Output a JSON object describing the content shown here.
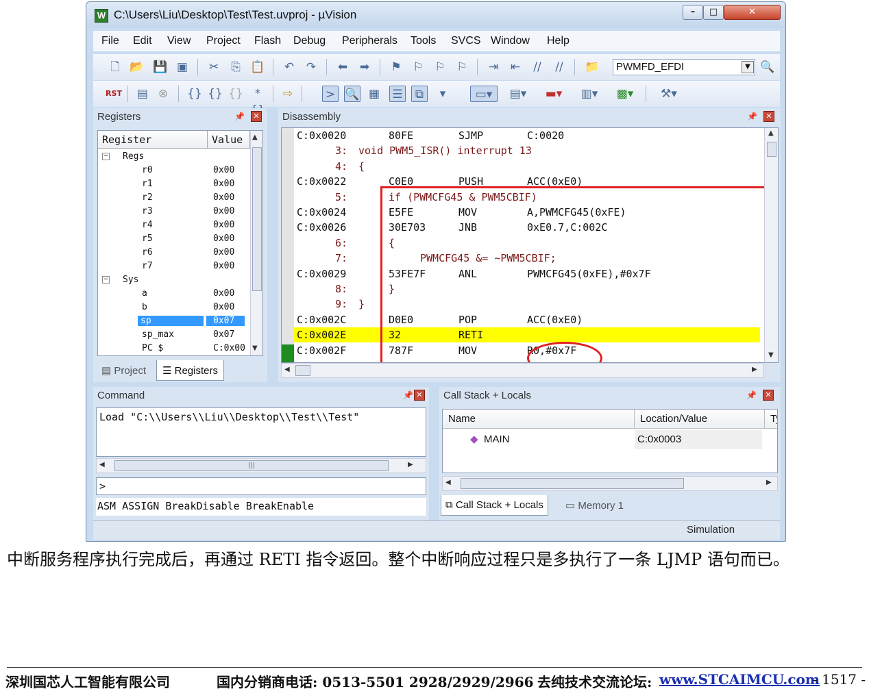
{
  "window": {
    "title": "C:\\Users\\Liu\\Desktop\\Test\\Test.uvproj - µVision"
  },
  "menu": [
    "File",
    "Edit",
    "View",
    "Project",
    "Flash",
    "Debug",
    "Peripherals",
    "Tools",
    "SVCS",
    "Window",
    "Help"
  ],
  "toolbar": {
    "target": "PWMFD_EFDI",
    "rst_label": "RST"
  },
  "registers": {
    "title": "Registers",
    "col_register": "Register",
    "col_value": "Value",
    "groups": [
      {
        "name": "Regs",
        "items": [
          {
            "name": "r0",
            "value": "0x00"
          },
          {
            "name": "r1",
            "value": "0x00"
          },
          {
            "name": "r2",
            "value": "0x00"
          },
          {
            "name": "r3",
            "value": "0x00"
          },
          {
            "name": "r4",
            "value": "0x00"
          },
          {
            "name": "r5",
            "value": "0x00"
          },
          {
            "name": "r6",
            "value": "0x00"
          },
          {
            "name": "r7",
            "value": "0x00"
          }
        ]
      },
      {
        "name": "Sys",
        "items": [
          {
            "name": "a",
            "value": "0x00"
          },
          {
            "name": "b",
            "value": "0x00"
          },
          {
            "name": "sp",
            "value": "0x07",
            "selected": true
          },
          {
            "name": "sp_max",
            "value": "0x07"
          },
          {
            "name": "PC  $",
            "value": "C:0x00"
          }
        ]
      }
    ],
    "tabs": [
      "Project",
      "Registers"
    ]
  },
  "disassembly": {
    "title": "Disassembly",
    "lines": [
      {
        "kind": "asm",
        "addr": "C:0x0020",
        "code": "80FE",
        "mnem": "SJMP",
        "ops": "C:0020"
      },
      {
        "kind": "src",
        "num": "3:",
        "text": "void PWM5_ISR() interrupt 13"
      },
      {
        "kind": "src",
        "num": "4:",
        "text": "{"
      },
      {
        "kind": "asm",
        "addr": "C:0x0022",
        "code": "C0E0",
        "mnem": "PUSH",
        "ops": "ACC(0xE0)"
      },
      {
        "kind": "src",
        "num": "5:",
        "text": "if (PWMCFG45 & PWM5CBIF)"
      },
      {
        "kind": "asm",
        "addr": "C:0x0024",
        "code": "E5FE",
        "mnem": "MOV",
        "ops": "A,PWMCFG45(0xFE)"
      },
      {
        "kind": "asm",
        "addr": "C:0x0026",
        "code": "30E703",
        "mnem": "JNB",
        "ops": "0xE0.7,C:002C"
      },
      {
        "kind": "src",
        "num": "6:",
        "text": "{"
      },
      {
        "kind": "src2",
        "num": "7:",
        "text": "PWMCFG45 &= ~PWM5CBIF;"
      },
      {
        "kind": "asm",
        "addr": "C:0x0029",
        "code": "53FE7F",
        "mnem": "ANL",
        "ops": "PWMCFG45(0xFE),#0x7F"
      },
      {
        "kind": "src",
        "num": "8:",
        "text": "}"
      },
      {
        "kind": "src",
        "num": "9:",
        "text": "}"
      },
      {
        "kind": "asm",
        "addr": "C:0x002C",
        "code": "D0E0",
        "mnem": "POP",
        "ops": "ACC(0xE0)"
      },
      {
        "kind": "asm",
        "addr": "C:0x002E",
        "code": "32",
        "mnem": "RETI",
        "ops": "",
        "current": true
      },
      {
        "kind": "asm",
        "addr": "C:0x002F",
        "code": "787F",
        "mnem": "MOV",
        "ops": "R0,#0x7F"
      }
    ]
  },
  "command": {
    "title": "Command",
    "output": "Load \"C:\\\\Users\\\\Liu\\\\Desktop\\\\Test\\\\Test\"",
    "prompt": ">",
    "hint": "ASM ASSIGN BreakDisable BreakEnable"
  },
  "callstack": {
    "title": "Call Stack + Locals",
    "col_name": "Name",
    "col_location": "Location/Value",
    "col_type": "Ty",
    "rows": [
      {
        "name": "MAIN",
        "location": "C:0x0003"
      }
    ],
    "tabs": [
      "Call Stack + Locals",
      "Memory 1"
    ]
  },
  "status": {
    "mode": "Simulation"
  },
  "document": {
    "paragraph": "中断服务程序执行完成后，再通过 RETI 指令返回。整个中断响应过程只是多执行了一条 LJMP 语句而已。",
    "footer_company": "深圳国芯人工智能有限公司",
    "footer_phone": "国内分销商电话: 0513-5501 2928/2929/2966",
    "footer_forum": "去纯技术交流论坛:",
    "footer_link": "www.STCAIMCU.com",
    "page": "- 1517 -"
  },
  "colors": {
    "highlight": "#ffff00",
    "annotation": "#e02020",
    "selection": "#3399ff"
  }
}
